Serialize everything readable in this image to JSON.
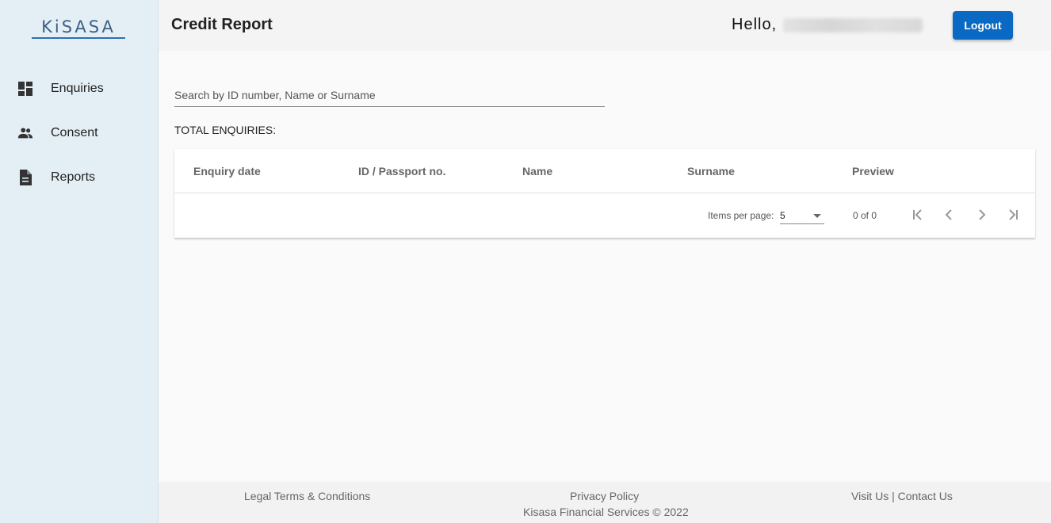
{
  "brand": {
    "logo_text": "KiSASA"
  },
  "sidebar": {
    "items": [
      {
        "label": "Enquiries",
        "icon": "dashboard-icon"
      },
      {
        "label": "Consent",
        "icon": "people-icon"
      },
      {
        "label": "Reports",
        "icon": "description-icon"
      }
    ]
  },
  "header": {
    "title": "Credit Report",
    "greeting": "Hello,",
    "logout_label": "Logout",
    "accent_color": "#0a69c2"
  },
  "search": {
    "placeholder": "Search by ID number, Name or Surname",
    "value": ""
  },
  "summary": {
    "total_label": "TOTAL ENQUIRIES:"
  },
  "table": {
    "columns": [
      "Enquiry date",
      "ID / Passport no.",
      "Name",
      "Surname",
      "Preview"
    ],
    "rows": []
  },
  "paginator": {
    "items_per_page_label": "Items per page:",
    "items_per_page": "5",
    "range_label": "0 of 0"
  },
  "footer": {
    "legal": "Legal Terms & Conditions",
    "privacy": "Privacy Policy",
    "visit": "Visit Us",
    "separator": "|",
    "contact": "Contact Us",
    "copyright": "Kisasa Financial Services © 2022"
  }
}
